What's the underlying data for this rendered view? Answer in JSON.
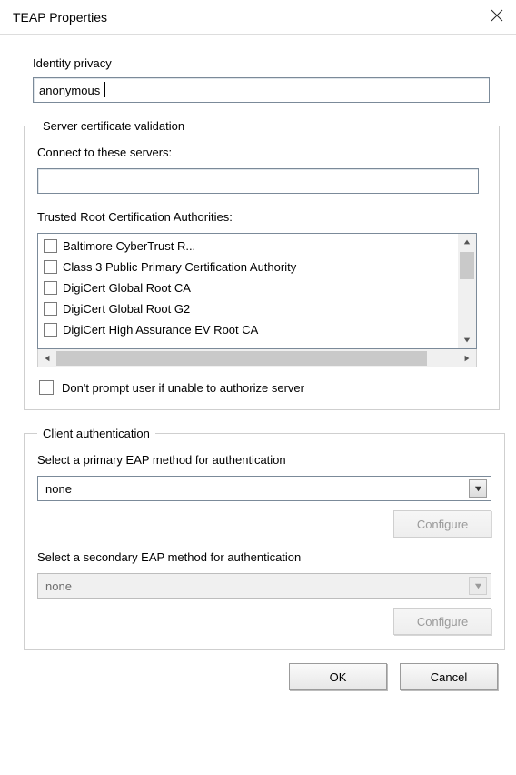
{
  "window": {
    "title": "TEAP Properties"
  },
  "identity": {
    "label": "Identity privacy",
    "value": "anonymous"
  },
  "serverValidation": {
    "legend": "Server certificate validation",
    "connectToLabel": "Connect to these servers:",
    "connectToValue": "",
    "trustedRootLabel": "Trusted Root Certification Authorities:",
    "authorities": [
      "Baltimore CyberTrust R...",
      "Class 3 Public Primary Certification Authority",
      "DigiCert Global Root CA",
      "DigiCert Global Root G2",
      "DigiCert High Assurance EV Root CA"
    ],
    "dontPromptLabel": "Don't prompt user if unable to authorize server"
  },
  "clientAuth": {
    "legend": "Client authentication",
    "primaryLabel": "Select a primary EAP method for authentication",
    "primaryValue": "none",
    "secondaryLabel": "Select a secondary EAP method for authentication",
    "secondaryValue": "none",
    "configureLabel": "Configure"
  },
  "buttons": {
    "ok": "OK",
    "cancel": "Cancel"
  }
}
